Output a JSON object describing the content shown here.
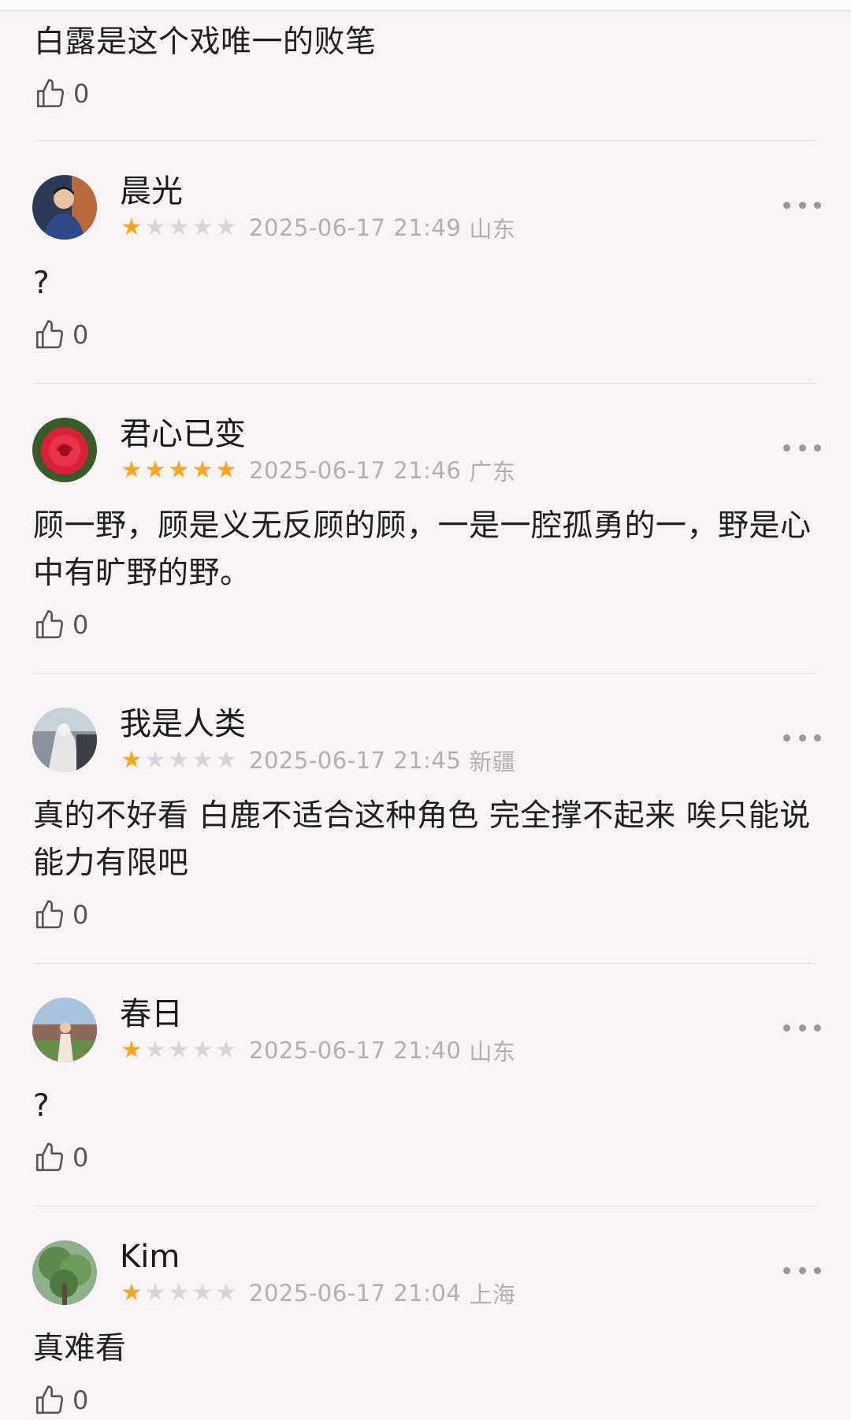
{
  "first_comment": {
    "text": "白露是这个戏唯一的败笔",
    "likes": "0"
  },
  "reviews": [
    {
      "user": "晨光",
      "rating": 1,
      "date": "2025-06-17 21:49",
      "location": "山东",
      "text": "?",
      "likes": "0"
    },
    {
      "user": "君心已变",
      "rating": 5,
      "date": "2025-06-17 21:46",
      "location": "广东",
      "text": "顾一野，顾是义无反顾的顾，一是一腔孤勇的一，野是心中有旷野的野。",
      "likes": "0"
    },
    {
      "user": "我是人类",
      "rating": 1,
      "date": "2025-06-17 21:45",
      "location": "新疆",
      "text": "真的不好看 白鹿不适合这种角色 完全撑不起来 唉只能说能力有限吧",
      "likes": "0"
    },
    {
      "user": "春日",
      "rating": 1,
      "date": "2025-06-17 21:40",
      "location": "山东",
      "text": "?",
      "likes": "0"
    },
    {
      "user": "Kim",
      "rating": 1,
      "date": "2025-06-17 21:04",
      "location": "上海",
      "text": "真难看",
      "likes": "0"
    }
  ],
  "colors": {
    "star_on": "#f5a623",
    "star_off": "#d9d6d8",
    "meta_text": "#b3b0b2",
    "background": "#f8f4f6"
  },
  "icons": {
    "like": "thumbs-up-icon",
    "more": "more-dots-icon",
    "star": "star-icon"
  }
}
